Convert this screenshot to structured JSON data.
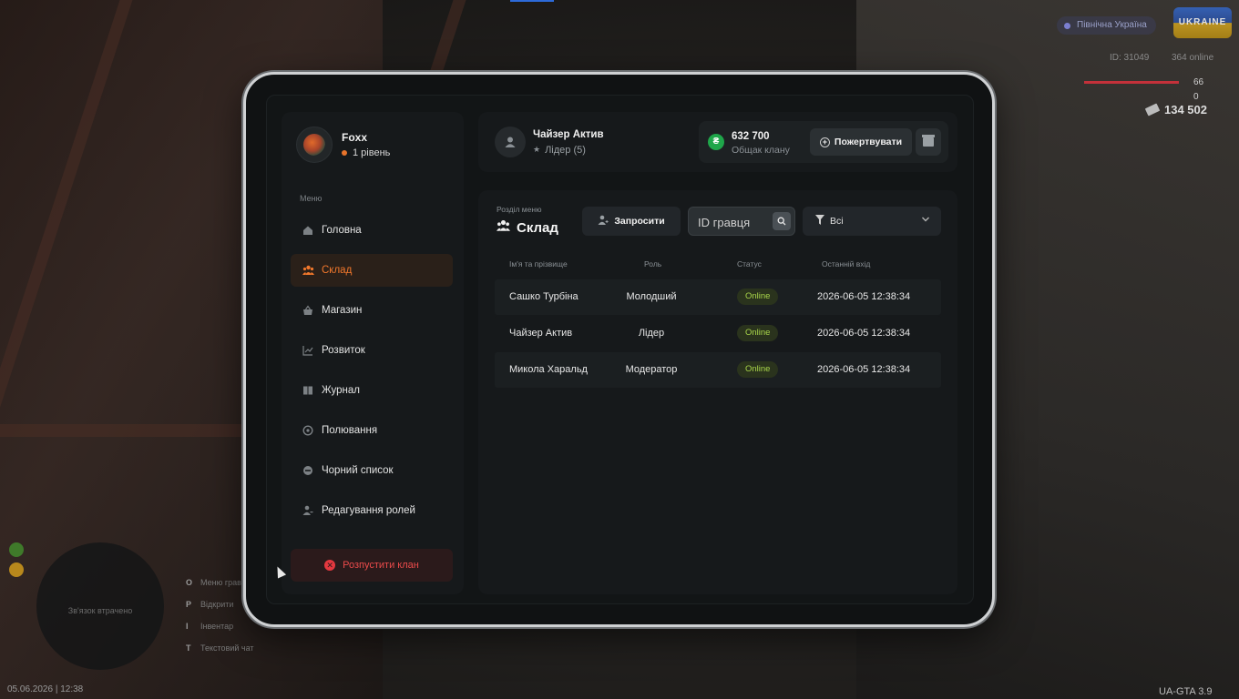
{
  "hud": {
    "region": "Північна Україна",
    "logo_text": "UKRAINE",
    "player_id": "ID: 31049",
    "online": "364 online",
    "health": "66",
    "armor": "0",
    "money": "134 502",
    "datetime": "05.06.2026 | 12:38",
    "version": "UA-GTA 3.9",
    "radar_text": "Зв'язок втрачено",
    "hotkeys": [
      {
        "key": "O",
        "label": "Меню гравця"
      },
      {
        "key": "P",
        "label": "Відкрити"
      },
      {
        "key": "I",
        "label": "Інвентар"
      },
      {
        "key": "T",
        "label": "Текстовий чат"
      }
    ],
    "indicator_colors": [
      "#3f7a2a",
      "#b8881c"
    ]
  },
  "sidebar": {
    "profile": {
      "name": "Foxx",
      "level": "1 рівень"
    },
    "menu_caption": "Меню",
    "items": [
      {
        "label": "Головна",
        "icon": "home-icon"
      },
      {
        "label": "Склад",
        "icon": "users-icon",
        "active": true
      },
      {
        "label": "Магазин",
        "icon": "basket-icon"
      },
      {
        "label": "Розвиток",
        "icon": "chart-icon"
      },
      {
        "label": "Журнал",
        "icon": "book-icon"
      },
      {
        "label": "Полювання",
        "icon": "target-icon"
      },
      {
        "label": "Чорний список",
        "icon": "block-icon"
      },
      {
        "label": "Редагування ролей",
        "icon": "user-edit-icon"
      }
    ],
    "disband_label": "Розпустити клан"
  },
  "header": {
    "leader_name": "Чайзер Актив",
    "leader_role": "Лідер (5)",
    "bank_amount": "632 700",
    "bank_caption": "Общак клану",
    "donate_label": "Пожертвувати"
  },
  "content": {
    "section_caption": "Розділ меню",
    "section_title": "Склад",
    "invite_label": "Запросити",
    "search_placeholder": "ID гравця",
    "filter_value": "Всі",
    "columns": [
      "Ім'я та прізвище",
      "Роль",
      "Статус",
      "Останній вхід"
    ],
    "rows": [
      {
        "name": "Сашко Турбіна",
        "role": "Молодший",
        "status": "Online",
        "last": "2026-06-05 12:38:34"
      },
      {
        "name": "Чайзер Актив",
        "role": "Лідер",
        "status": "Online",
        "last": "2026-06-05 12:38:34"
      },
      {
        "name": "Микола Харальд",
        "role": "Модератор",
        "status": "Online",
        "last": "2026-06-05 12:38:34"
      }
    ]
  },
  "colors": {
    "accent": "#f2782c",
    "online": "#a9d64a",
    "danger": "#ec4b4b",
    "coin": "#1fa64a"
  }
}
